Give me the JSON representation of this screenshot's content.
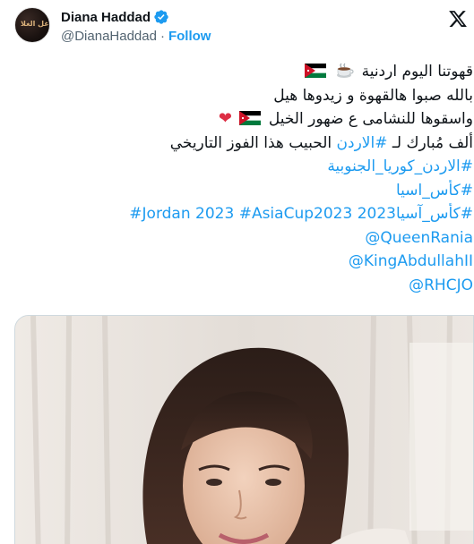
{
  "user": {
    "display_name": "Diana Haddad",
    "handle": "@DianaHaddad",
    "separator": "·",
    "follow_label": "Follow",
    "avatar_text": "غل الغلا"
  },
  "icons": {
    "verified": "verified-badge-icon",
    "x_logo": "x-logo-icon",
    "coffee": "hot-beverage-icon",
    "flag": "jordan-flag-icon",
    "heart": "red-heart-icon"
  },
  "colors": {
    "link": "#1d9bf0",
    "text": "#0f1419",
    "secondary": "#536471",
    "heart": "#dd2e44"
  },
  "tweet": {
    "line1_text": "قهوتنا اليوم اردنية",
    "line2_text": "بالله صبوا هالقهوة و زيدوها هيل",
    "line3_text": "واسقوها للنشامى ع ضهور الخيل",
    "line4_prefix": "ألف مُبارك لـ",
    "line4_hashtag": "#الاردن",
    "line4_suffix": "الحبيب هذا الفوز التاريخي",
    "hashtag_korea": "#الاردن_كوريا_الجنوبية",
    "hashtag_asia": "#كأس_اسيا",
    "hashtag_asia2": "#كأس_آسيا2023",
    "hashtag_jordan2023": "#Jordan 2023",
    "hashtag_asiacup": "#AsiaCup2023",
    "mention_queen": "@QueenRania",
    "mention_king": "@KingAbdullahII",
    "mention_rhc": "@RHCJO",
    "heart_glyph": "❤"
  }
}
